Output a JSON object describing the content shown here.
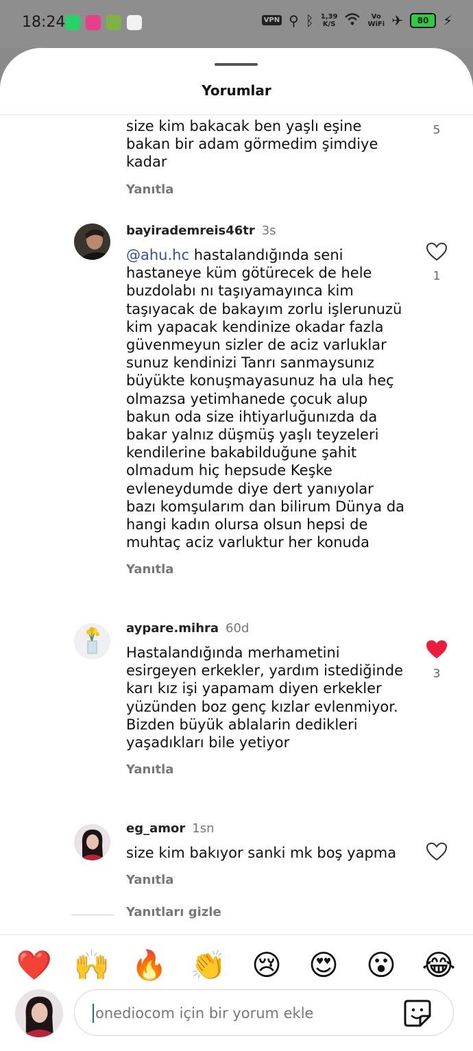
{
  "status_bar": {
    "time": "18:24",
    "vpn": "VPN",
    "speed_value": "1,39",
    "speed_unit": "K/S",
    "wifi_label_top": "Vo",
    "wifi_label_bottom": "WiFi",
    "battery": "80"
  },
  "sheet": {
    "title": "Yorumlar"
  },
  "comments": [
    {
      "text": "size kim bakacak ben yaşlı eşine bakan bir adam görmedim şimdiye kadar",
      "reply": "Yanıtla",
      "like_count": "5"
    },
    {
      "user": "bayirademreis46tr",
      "time": "3s",
      "mention": "@ahu.hc",
      "text": " hastalandığında seni hastaneye küm götürecek de hele buzdolabı nı taşıyamayınca kim taşıyacak de bakayım  zorlu işlerunuzü kim yapacak  kendinize okadar fazla güvenmeyun sizler de aciz varluklar sunuz  kendinizi Tanrı sanmaysunız büyükte konuşmayasunuz  ha ula heç olmazsa yetimhanede çocuk alup bakun oda size ihtiyarluğunızda da bakar yalnız düşmüş yaşlı teyzeleri kendilerine bakabilduğune şahit olmadum hiç hepsude Keşke evleneydumde diye dert yanıyolar bazı komşularım dan bilirum Dünya da hangi kadın olursa olsun hepsi de muhtaç aciz varluktur her konuda",
      "reply": "Yanıtla",
      "like_count": "1"
    },
    {
      "user": "aypare.mihra",
      "time": "60d",
      "text": "Hastalandığında merhametini esirgeyen erkekler, yardım istediğinde karı kız işi yapamam diyen erkekler yüzünden boz genç kızlar evlenmiyor. Bizden büyük ablalarin dedikleri yaşadıkları bile yetiyor",
      "reply": "Yanıtla",
      "like_count": "3",
      "liked": true
    },
    {
      "user": "eg_amor",
      "time": "1sn",
      "text": "size kim bakıyor sanki mk boş yapma",
      "reply": "Yanıtla"
    }
  ],
  "hide_replies": "Yanıtları gizle",
  "quick_emojis": [
    "❤️",
    "🙌",
    "🔥",
    "👏",
    "😢",
    "😍",
    "😮",
    "😂"
  ],
  "composer": {
    "placeholder": "onediocom için bir yorum ekle",
    "sticker_icon": "sticker-icon"
  },
  "colors": {
    "mention": "#3a4ea0",
    "liked_heart": "#ed1c3b",
    "battery": "#2ecc40"
  }
}
